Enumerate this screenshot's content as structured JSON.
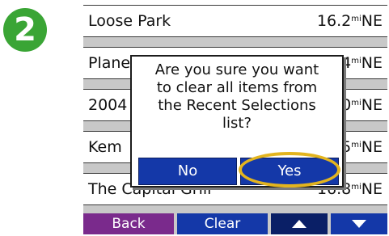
{
  "step_badge": "2",
  "list": {
    "rows": [
      {
        "name": "Loose Park",
        "distance": "16.2",
        "unit": "mi",
        "direction": "NE"
      },
      {
        "name": "Plane",
        "distance": "4",
        "unit": "mi",
        "direction": "NE"
      },
      {
        "name": "2004",
        "distance": "0",
        "unit": "mi",
        "direction": "NE"
      },
      {
        "name": "Kem",
        "distance": "5",
        "unit": "mi",
        "direction": "NE"
      },
      {
        "name": "The Capital Grill",
        "distance": "16.8",
        "unit": "mi",
        "direction": "NE"
      }
    ]
  },
  "dialog": {
    "message_line1": "Are you sure you want",
    "message_line2": "to clear all items from",
    "message_line3": "the Recent Selections",
    "message_line4": "list?",
    "no_label": "No",
    "yes_label": "Yes"
  },
  "toolbar": {
    "back_label": "Back",
    "clear_label": "Clear",
    "up_icon": "triangle-up-icon",
    "down_icon": "triangle-down-icon"
  },
  "colors": {
    "badge": "#3aa535",
    "back_button": "#7a2a8c",
    "clear_button": "#1438a8",
    "scroll_buttons": "#1438a8",
    "highlight": "#e3b41e"
  }
}
